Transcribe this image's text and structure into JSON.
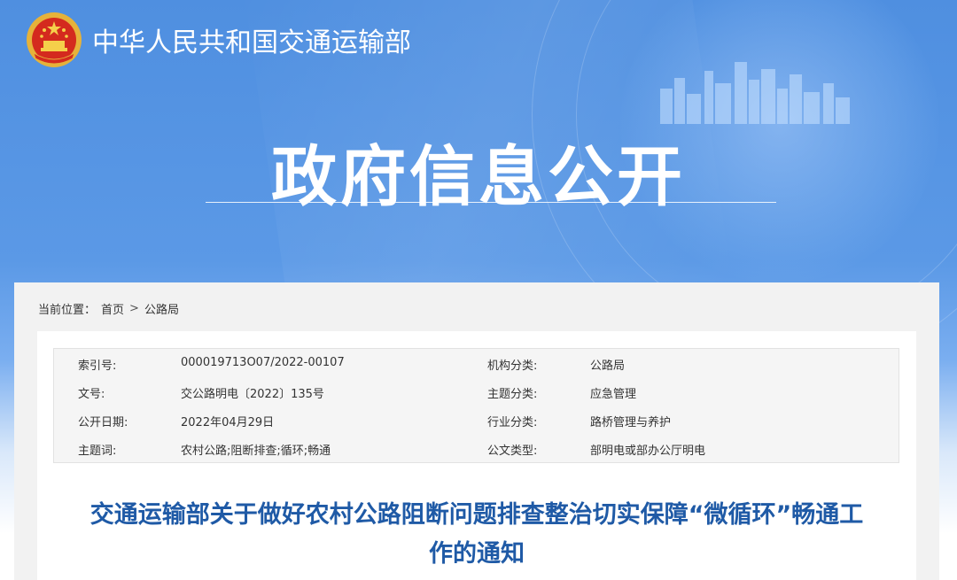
{
  "header": {
    "site_name": "中华人民共和国交通运输部",
    "main_title": "政府信息公开",
    "emblem_icon": "national-emblem-icon"
  },
  "colors": {
    "banner_blue": "#5b99e6",
    "title_blue": "#1f5aa6"
  },
  "breadcrumb": {
    "prefix": "当前位置：",
    "home": "首页",
    "separator": ">",
    "current": "公路局"
  },
  "meta": {
    "rows": [
      {
        "k1": "索引号:",
        "v1": "000019713O07/2022-00107",
        "k2": "机构分类:",
        "v2": "公路局"
      },
      {
        "k1": "文号:",
        "v1": "交公路明电〔2022〕135号",
        "k2": "主题分类:",
        "v2": "应急管理"
      },
      {
        "k1": "公开日期:",
        "v1": "2022年04月29日",
        "k2": "行业分类:",
        "v2": "路桥管理与养护"
      },
      {
        "k1": "主题词:",
        "v1": "农村公路;阻断排查;循环;畅通",
        "k2": "公文类型:",
        "v2": "部明电或部办公厅明电"
      }
    ]
  },
  "document": {
    "title_line1": "交通运输部关于做好农村公路阻断问题排查整治切实保障“微循环”畅通工",
    "title_line2": "作的通知"
  }
}
